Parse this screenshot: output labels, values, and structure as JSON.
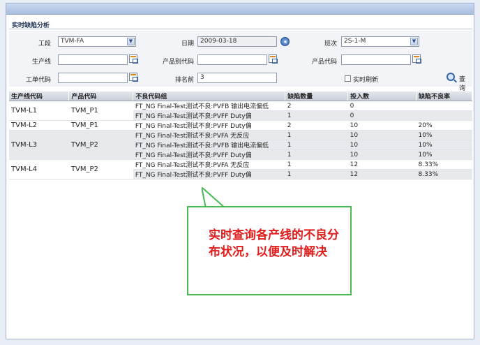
{
  "panel": {
    "title": "实时缺陷分析"
  },
  "form": {
    "process_label": "工段",
    "process_value": "TVM-FA",
    "date_label": "日期",
    "date_value": "2009-03-18",
    "shift_label": "班次",
    "shift_value": "2S-1-M",
    "line_label": "生产线",
    "line_value": "",
    "product_class_label": "产品别代码",
    "product_class_value": "",
    "product_code_label": "产品代码",
    "product_code_value": "",
    "work_order_label": "工单代码",
    "work_order_value": "",
    "rank_label": "排名前",
    "rank_value": "3",
    "realtime_refresh_label": "实时刷新",
    "query_label": "查 询"
  },
  "table": {
    "headers": [
      "生产线代码",
      "产品代码",
      "不良代码组",
      "缺陷数量",
      "投入数",
      "缺陷不良率"
    ],
    "groups": [
      {
        "line": "TVM-L1",
        "product": "TVM_P1",
        "rows": [
          {
            "defect": "FT_NG Final-Test测试不良:PVFB 输出电流偏低",
            "qty": "2",
            "input": "0",
            "rate": ""
          },
          {
            "defect": "FT_NG Final-Test测试不良:PVFF Duty偏",
            "qty": "1",
            "input": "0",
            "rate": ""
          }
        ]
      },
      {
        "line": "TVM-L2",
        "product": "TVM_P1",
        "rows": [
          {
            "defect": "FT_NG Final-Test测试不良:PVFF Duty偏",
            "qty": "2",
            "input": "10",
            "rate": "20%"
          }
        ]
      },
      {
        "line": "TVM-L3",
        "product": "TVM_P2",
        "rows": [
          {
            "defect": "FT_NG Final-Test测试不良:PVFA 无反应",
            "qty": "1",
            "input": "10",
            "rate": "10%"
          },
          {
            "defect": "FT_NG Final-Test测试不良:PVFB 输出电流偏低",
            "qty": "1",
            "input": "10",
            "rate": "10%"
          },
          {
            "defect": "FT_NG Final-Test测试不良:PVFF Duty偏",
            "qty": "1",
            "input": "10",
            "rate": "10%"
          }
        ]
      },
      {
        "line": "TVM-L4",
        "product": "TVM_P2",
        "rows": [
          {
            "defect": "FT_NG Final-Test测试不良:PVFA 无反应",
            "qty": "1",
            "input": "12",
            "rate": "8.33%"
          },
          {
            "defect": "FT_NG Final-Test测试不良:PVFF Duty偏",
            "qty": "1",
            "input": "12",
            "rate": "8.33%"
          }
        ]
      }
    ]
  },
  "callout": {
    "text": "实时查询各产线的不良分布状况，以便及时解决"
  },
  "colors": {
    "callout_border": "#4aba55",
    "callout_text": "#e21b1b",
    "header_bar": "#a8bfe0"
  }
}
